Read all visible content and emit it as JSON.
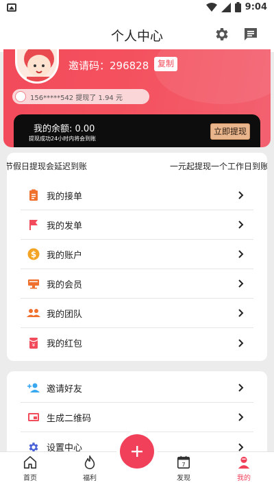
{
  "status": {
    "time": "9:04"
  },
  "header": {
    "title": "个人中心",
    "settings_icon": "gear-icon",
    "message_icon": "message-icon"
  },
  "profile": {
    "invite_text": "邀请码：296828",
    "copy_label": "复制",
    "notice": "156*****542 提现了 1.94 元"
  },
  "balance": {
    "label": "我的余额: 0.00",
    "sub": "提现成功24小时内将会到账",
    "withdraw_label": "立即提现"
  },
  "tips": {
    "left": "节假日提现会延迟到账",
    "right": "一元起提现一个工作日到账"
  },
  "menu1": [
    {
      "label": "我的接单",
      "icon": "clipboard-icon",
      "color": "#f0702e"
    },
    {
      "label": "我的发单",
      "icon": "flag-icon",
      "color": "#f24b5b"
    },
    {
      "label": "我的账户",
      "icon": "dollar-icon",
      "color": "#f4a424"
    },
    {
      "label": "我的会员",
      "icon": "member-icon",
      "color": "#f0702e"
    },
    {
      "label": "我的团队",
      "icon": "team-icon",
      "color": "#f0702e"
    },
    {
      "label": "我的红包",
      "icon": "red-packet-icon",
      "color": "#f24b5b"
    }
  ],
  "menu2": [
    {
      "label": "邀请好友",
      "icon": "add-friend-icon",
      "color": "#39a8f0"
    },
    {
      "label": "生成二维码",
      "icon": "qrcode-icon",
      "color": "#f24b5b"
    },
    {
      "label": "设置中心",
      "icon": "settings-icon",
      "color": "#4a62d8"
    }
  ],
  "tabbar": {
    "items": [
      {
        "label": "首页",
        "icon": "home-icon"
      },
      {
        "label": "福利",
        "icon": "flame-icon"
      },
      {
        "label": "发现",
        "icon": "calendar-icon",
        "badge": "7"
      },
      {
        "label": "我的",
        "icon": "profile-icon"
      }
    ],
    "active_color": "#f0405a"
  },
  "colors": {
    "brand": "#f24b5b",
    "fab": "#f0405a"
  }
}
